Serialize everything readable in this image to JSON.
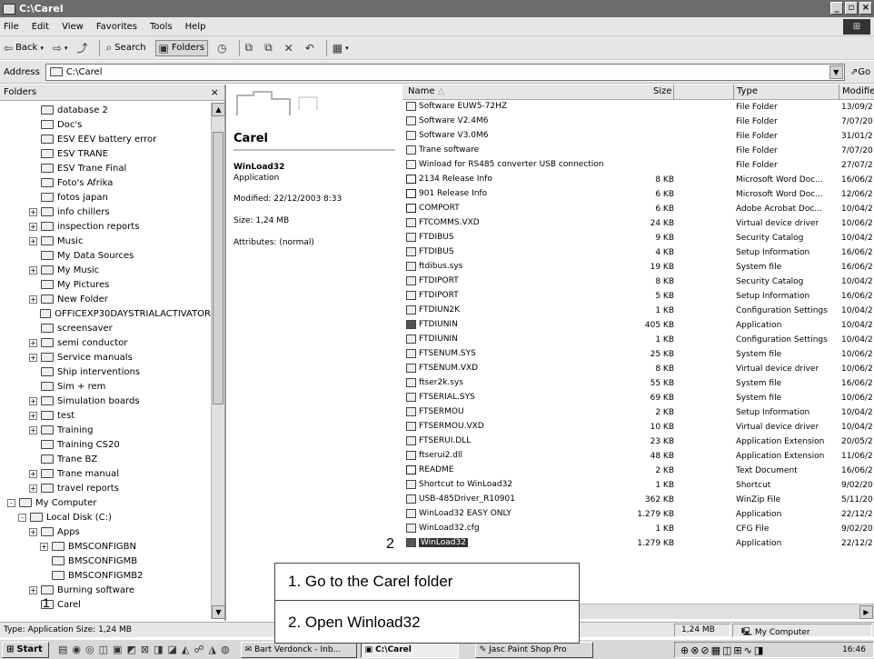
{
  "window": {
    "title": "C:\\Carel",
    "buttons": [
      "_",
      "▫",
      "×"
    ]
  },
  "menu": [
    "File",
    "Edit",
    "View",
    "Favorites",
    "Tools",
    "Help"
  ],
  "toolbar": {
    "back": "Back",
    "search": "Search",
    "folders": "Folders"
  },
  "address": {
    "label": "Address",
    "value": "C:\\Carel",
    "go": "Go"
  },
  "folders_pane": {
    "title": "Folders",
    "close": "×",
    "items": [
      {
        "label": "database 2",
        "indent": 2,
        "expander": ""
      },
      {
        "label": "Doc's",
        "indent": 2,
        "expander": ""
      },
      {
        "label": "ESV EEV battery error",
        "indent": 2,
        "expander": ""
      },
      {
        "label": "ESV TRANE",
        "indent": 2,
        "expander": ""
      },
      {
        "label": "ESV Trane Final",
        "indent": 2,
        "expander": ""
      },
      {
        "label": "Foto's Afrika",
        "indent": 2,
        "expander": ""
      },
      {
        "label": "fotos japan",
        "indent": 2,
        "expander": ""
      },
      {
        "label": "info chillers",
        "indent": 2,
        "expander": "+"
      },
      {
        "label": "inspection reports",
        "indent": 2,
        "expander": "+"
      },
      {
        "label": "Music",
        "indent": 2,
        "expander": "+"
      },
      {
        "label": "My Data Sources",
        "indent": 2,
        "expander": ""
      },
      {
        "label": "My Music",
        "indent": 2,
        "expander": "+"
      },
      {
        "label": "My Pictures",
        "indent": 2,
        "expander": ""
      },
      {
        "label": "New Folder",
        "indent": 2,
        "expander": "+"
      },
      {
        "label": "OFFICEXP30DAYSTRIALACTIVATOR",
        "indent": 2,
        "expander": ""
      },
      {
        "label": "screensaver",
        "indent": 2,
        "expander": ""
      },
      {
        "label": "semi conductor",
        "indent": 2,
        "expander": "+"
      },
      {
        "label": "Service manuals",
        "indent": 2,
        "expander": "+"
      },
      {
        "label": "Ship interventions",
        "indent": 2,
        "expander": ""
      },
      {
        "label": "Sim + rem",
        "indent": 2,
        "expander": ""
      },
      {
        "label": "Simulation boards",
        "indent": 2,
        "expander": "+"
      },
      {
        "label": "test",
        "indent": 2,
        "expander": "+"
      },
      {
        "label": "Training",
        "indent": 2,
        "expander": "+"
      },
      {
        "label": "Training CS20",
        "indent": 2,
        "expander": ""
      },
      {
        "label": "Trane BZ",
        "indent": 2,
        "expander": ""
      },
      {
        "label": "Trane manual",
        "indent": 2,
        "expander": "+"
      },
      {
        "label": "travel reports",
        "indent": 2,
        "expander": "+"
      },
      {
        "label": "My Computer",
        "indent": 0,
        "expander": "-"
      },
      {
        "label": "Local Disk (C:)",
        "indent": 1,
        "expander": "-"
      },
      {
        "label": "Apps",
        "indent": 2,
        "expander": "+"
      },
      {
        "label": "BMSCONFIGBN",
        "indent": 3,
        "expander": "+"
      },
      {
        "label": "BMSCONFIGMB",
        "indent": 3,
        "expander": ""
      },
      {
        "label": "BMSCONFIGMB2",
        "indent": 3,
        "expander": ""
      },
      {
        "label": "Burning software",
        "indent": 2,
        "expander": "+"
      },
      {
        "label": "Carel",
        "indent": 2,
        "expander": ""
      }
    ]
  },
  "details": {
    "folder_name": "Carel",
    "selected_name": "WinLoad32",
    "selected_kind": "Application",
    "modified": "Modified: 22/12/2003 8:33",
    "size": "Size: 1,24 MB",
    "attributes": "Attributes: (normal)"
  },
  "list_headers": {
    "name": "Name",
    "size": "Size",
    "type": "Type",
    "modified": "Modified"
  },
  "files": [
    {
      "name": "Software EUW5-72HZ",
      "size": "",
      "type": "File Folder",
      "modified": "13/09/2",
      "icon": "folder"
    },
    {
      "name": "Software V2.4M6",
      "size": "",
      "type": "File Folder",
      "modified": "7/07/20",
      "icon": "folder"
    },
    {
      "name": "Software V3.0M6",
      "size": "",
      "type": "File Folder",
      "modified": "31/01/2",
      "icon": "folder"
    },
    {
      "name": "Trane software",
      "size": "",
      "type": "File Folder",
      "modified": "7/07/20",
      "icon": "folder"
    },
    {
      "name": "Winload for RS485 converter USB connection",
      "size": "",
      "type": "File Folder",
      "modified": "27/07/2",
      "icon": "folder"
    },
    {
      "name": "2134 Release Info",
      "size": "8 KB",
      "type": "Microsoft Word Doc...",
      "modified": "16/06/2",
      "icon": "doc"
    },
    {
      "name": "901 Release Info",
      "size": "6 KB",
      "type": "Microsoft Word Doc...",
      "modified": "12/06/2",
      "icon": "doc"
    },
    {
      "name": "COMPORT",
      "size": "6 KB",
      "type": "Adobe Acrobat Doc...",
      "modified": "10/04/2",
      "icon": "doc"
    },
    {
      "name": "FTCOMMS.VXD",
      "size": "24 KB",
      "type": "Virtual device driver",
      "modified": "10/06/2",
      "icon": "file"
    },
    {
      "name": "FTDIBUS",
      "size": "9 KB",
      "type": "Security Catalog",
      "modified": "10/04/2",
      "icon": "file"
    },
    {
      "name": "FTDIBUS",
      "size": "4 KB",
      "type": "Setup Information",
      "modified": "16/06/2",
      "icon": "file"
    },
    {
      "name": "ftdibus.sys",
      "size": "19 KB",
      "type": "System file",
      "modified": "16/06/2",
      "icon": "file"
    },
    {
      "name": "FTDIPORT",
      "size": "8 KB",
      "type": "Security Catalog",
      "modified": "10/04/2",
      "icon": "file"
    },
    {
      "name": "FTDIPORT",
      "size": "5 KB",
      "type": "Setup Information",
      "modified": "16/06/2",
      "icon": "file"
    },
    {
      "name": "FTDIUN2K",
      "size": "1 KB",
      "type": "Configuration Settings",
      "modified": "10/04/2",
      "icon": "file"
    },
    {
      "name": "FTDIUNIN",
      "size": "405 KB",
      "type": "Application",
      "modified": "10/04/2",
      "icon": "app"
    },
    {
      "name": "FTDIUNIN",
      "size": "1 KB",
      "type": "Configuration Settings",
      "modified": "10/04/2",
      "icon": "file"
    },
    {
      "name": "FTSENUM.SYS",
      "size": "25 KB",
      "type": "System file",
      "modified": "10/06/2",
      "icon": "file"
    },
    {
      "name": "FTSENUM.VXD",
      "size": "8 KB",
      "type": "Virtual device driver",
      "modified": "10/06/2",
      "icon": "file"
    },
    {
      "name": "ftser2k.sys",
      "size": "55 KB",
      "type": "System file",
      "modified": "16/06/2",
      "icon": "file"
    },
    {
      "name": "FTSERIAL.SYS",
      "size": "69 KB",
      "type": "System file",
      "modified": "10/06/2",
      "icon": "file"
    },
    {
      "name": "FTSERMOU",
      "size": "2 KB",
      "type": "Setup Information",
      "modified": "10/04/2",
      "icon": "file"
    },
    {
      "name": "FTSERMOU.VXD",
      "size": "10 KB",
      "type": "Virtual device driver",
      "modified": "10/04/2",
      "icon": "file"
    },
    {
      "name": "FTSERUI.DLL",
      "size": "23 KB",
      "type": "Application Extension",
      "modified": "20/05/2",
      "icon": "file"
    },
    {
      "name": "ftserui2.dll",
      "size": "48 KB",
      "type": "Application Extension",
      "modified": "11/06/2",
      "icon": "file"
    },
    {
      "name": "README",
      "size": "2 KB",
      "type": "Text Document",
      "modified": "16/06/2",
      "icon": "doc"
    },
    {
      "name": "Shortcut to WinLoad32",
      "size": "1 KB",
      "type": "Shortcut",
      "modified": "9/02/20",
      "icon": "file"
    },
    {
      "name": "USB-485Driver_R10901",
      "size": "362 KB",
      "type": "WinZip File",
      "modified": "5/11/20",
      "icon": "file"
    },
    {
      "name": "WinLoad32 EASY ONLY",
      "size": "1.279 KB",
      "type": "Application",
      "modified": "22/12/2",
      "icon": "file"
    },
    {
      "name": "WinLoad32.cfg",
      "size": "1 KB",
      "type": "CFG File",
      "modified": "9/02/20",
      "icon": "file"
    },
    {
      "name": "WinLoad32",
      "size": "1.279 KB",
      "type": "Application",
      "modified": "22/12/2",
      "icon": "app",
      "selected": true
    }
  ],
  "status": {
    "left": "Type: Application Size: 1,24 MB",
    "size": "1,24 MB",
    "zone": "My Computer"
  },
  "taskbar": {
    "start": "Start",
    "tasks": [
      "Bart Verdonck - Inb...",
      "C:\\Carel",
      "Jasc Paint Shop Pro"
    ],
    "clock": "16:46"
  },
  "annotations": {
    "marker_1": "1",
    "marker_2": "2",
    "step_1": "1.  Go to the Carel folder",
    "step_2": "2.  Open Winload32"
  }
}
